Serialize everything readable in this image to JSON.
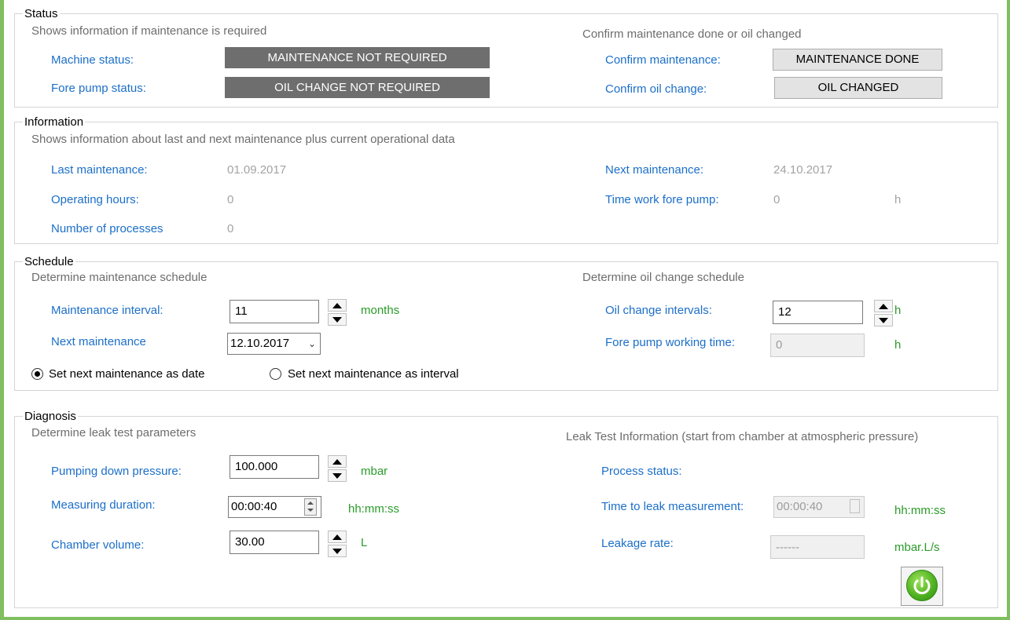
{
  "status": {
    "title": "Status",
    "subtitle_left": "Shows information if maintenance is required",
    "subtitle_right": "Confirm maintenance done or oil changed",
    "machine_status_label": "Machine status:",
    "machine_status_value": "MAINTENANCE NOT REQUIRED",
    "fore_pump_status_label": "Fore pump status:",
    "fore_pump_status_value": "OIL CHANGE NOT REQUIRED",
    "confirm_maintenance_label": "Confirm maintenance:",
    "confirm_maintenance_button": "MAINTENANCE DONE",
    "confirm_oil_label": "Confirm oil change:",
    "confirm_oil_button": "OIL CHANGED"
  },
  "information": {
    "title": "Information",
    "subtitle": "Shows information about last and next maintenance plus current operational data",
    "last_maintenance_label": "Last maintenance:",
    "last_maintenance_value": "01.09.2017",
    "operating_hours_label": "Operating hours:",
    "operating_hours_value": "0",
    "processes_label": "Number of processes",
    "processes_value": "0",
    "next_maintenance_label": "Next maintenance:",
    "next_maintenance_value": "24.10.2017",
    "fore_pump_time_label": "Time work fore pump:",
    "fore_pump_time_value": "0",
    "fore_pump_time_unit": "h"
  },
  "schedule": {
    "title": "Schedule",
    "subtitle_left": "Determine maintenance schedule",
    "subtitle_right": "Determine oil change schedule",
    "maintenance_interval_label": "Maintenance interval:",
    "maintenance_interval_value": "11",
    "maintenance_interval_unit": "months",
    "next_maintenance_label": "Next maintenance",
    "next_maintenance_date": "12.10.2017",
    "radio_date_label": "Set next maintenance as date",
    "radio_interval_label": "Set next maintenance as interval",
    "oil_interval_label": "Oil change intervals:",
    "oil_interval_value": "12",
    "oil_interval_unit": "h",
    "fore_pump_working_label": "Fore pump working time:",
    "fore_pump_working_value": "0",
    "fore_pump_working_unit": "h"
  },
  "diagnosis": {
    "title": "Diagnosis",
    "subtitle_left": "Determine leak test parameters",
    "subtitle_right": "Leak Test Information (start from chamber at atmospheric pressure)",
    "pumping_pressure_label": "Pumping down pressure:",
    "pumping_pressure_value": "100.000",
    "pumping_pressure_unit": "mbar",
    "measuring_duration_label": "Measuring duration:",
    "measuring_duration_value": "00:00:40",
    "measuring_duration_unit": "hh:mm:ss",
    "chamber_volume_label": "Chamber volume:",
    "chamber_volume_value": "30.00",
    "chamber_volume_unit": "L",
    "process_status_label": "Process status:",
    "time_to_leak_label": "Time to leak measurement:",
    "time_to_leak_value": "00:00:40",
    "time_to_leak_unit": "hh:mm:ss",
    "leakage_rate_label": "Leakage rate:",
    "leakage_rate_value": "------",
    "leakage_rate_unit": "mbar.L/s"
  },
  "icons": {
    "start_button": "power-icon"
  },
  "colors": {
    "label_blue": "#1c6fc8",
    "unit_green": "#2a9b2a",
    "status_gray": "#6e6e6e",
    "frame_green": "#7fbf5f"
  }
}
